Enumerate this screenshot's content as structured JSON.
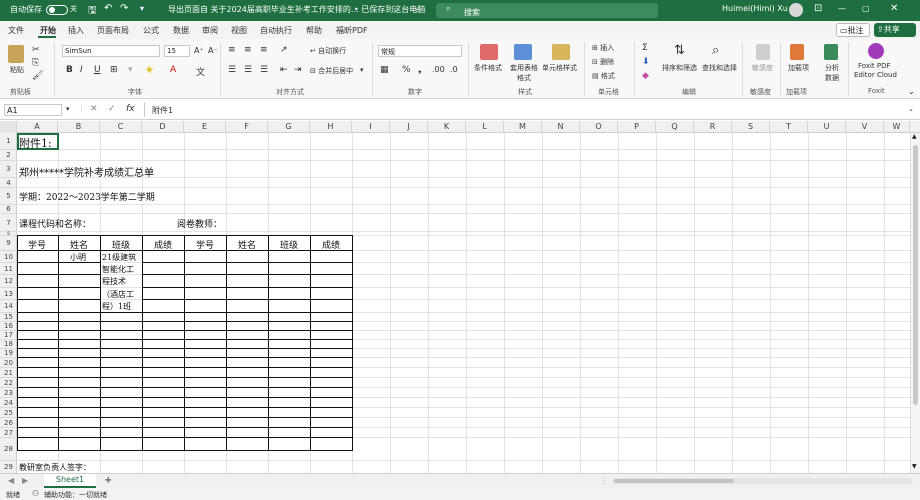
{
  "titlebar": {
    "autosave": "自动保存",
    "autosave_state": "关",
    "doc_title": "导出页面自 关于2024届高职毕业生补考工作安排的...",
    "save_status": "• 已保存到这台电脑",
    "search_placeholder": "搜索",
    "user": "Huimei(Himi) Xu",
    "comments": "批注",
    "share": "共享"
  },
  "menu": [
    "文件",
    "开始",
    "插入",
    "页面布局",
    "公式",
    "数据",
    "审阅",
    "视图",
    "自动执行",
    "帮助",
    "福昕PDF"
  ],
  "ribbon": {
    "clipboard": {
      "paste": "粘贴",
      "label": "剪贴板"
    },
    "font": {
      "name": "SimSun",
      "size": "15",
      "bold": "B",
      "italic": "I",
      "underline": "U",
      "label": "字体"
    },
    "align": {
      "wrap": "自动换行",
      "merge": "合并后居中",
      "label": "对齐方式"
    },
    "number": {
      "format": "常规",
      "label": "数字"
    },
    "styles": {
      "cond": "条件格式",
      "table": "套用表格格式",
      "cell": "单元格样式",
      "label": "样式"
    },
    "cells": {
      "insert": "插入",
      "delete": "删除",
      "format": "格式",
      "label": "单元格"
    },
    "edit": {
      "sort": "排序和筛选",
      "find": "查找和选择",
      "label": "编辑"
    },
    "sens": {
      "btn": "敏感度",
      "label": "敏感度"
    },
    "addins": {
      "btn": "加载项",
      "label": "加载项"
    },
    "analyze": {
      "btn": "分析数据"
    },
    "foxit": {
      "btn1": "Foxit PDF",
      "btn2": "Editor Cloud",
      "label": "Foxit"
    }
  },
  "formula": {
    "cellref": "A1",
    "fx": "fx",
    "content": "附件1"
  },
  "columns": [
    "A",
    "B",
    "C",
    "D",
    "E",
    "F",
    "G",
    "H",
    "I",
    "J",
    "K",
    "L",
    "M",
    "N",
    "O",
    "P",
    "Q",
    "R",
    "S",
    "T",
    "U",
    "V",
    "W"
  ],
  "rows": [
    "1",
    "2",
    "3",
    "4",
    "5",
    "6",
    "7",
    "8",
    "9",
    "10",
    "11",
    "12",
    "13",
    "14",
    "15",
    "16",
    "17",
    "18",
    "19",
    "20",
    "21",
    "22",
    "23",
    "24",
    "25",
    "26",
    "27",
    "28",
    "29"
  ],
  "sheet": {
    "annex": "附件1:",
    "title": "郑州*****学院补考成绩汇总单",
    "term": "学期：2022～2023学年第二学期",
    "course": "课程代码和名称：",
    "teacher": "阅卷教师：",
    "headers": [
      "学号",
      "姓名",
      "班级",
      "成绩",
      "学号",
      "姓名",
      "班级",
      "成绩"
    ],
    "name": "小明",
    "class_lines": [
      "21级建筑",
      "智能化工",
      "程技术",
      "（酒店工",
      "程）1班"
    ],
    "footer": "教研室负责人签字："
  },
  "tabs": {
    "sheet": "Sheet1",
    "add": "+"
  },
  "status": {
    "ready": "就绪",
    "access": "辅助功能：一切就绪"
  }
}
